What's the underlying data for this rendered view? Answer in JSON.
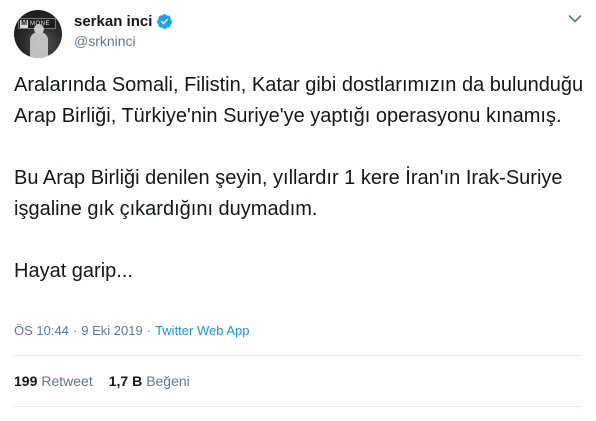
{
  "author": {
    "display_name": "serkan inci",
    "handle": "@srkninci",
    "avatar_badge": "MONE",
    "avatar_badge_letter": "M",
    "verified": true
  },
  "tweet": {
    "paragraphs": [
      "Aralarında Somali, Filistin, Katar gibi dostlarımızın da bulunduğu Arap Birliği, Türkiye'nin Suriye'ye yaptığı operasyonu kınamış.",
      "Bu Arap Birliği denilen şeyin, yıllardır 1 kere İran'ın Irak-Suriye işgaline gık çıkardığını duymadım.",
      "Hayat garip..."
    ],
    "time": "ÖS 10:44",
    "separator": "·",
    "date": "9 Eki 2019",
    "app": "Twitter Web App"
  },
  "stats": {
    "retweets_count": "199",
    "retweets_label": "Retweet",
    "likes_count": "1,7 B",
    "likes_label": "Beğeni"
  },
  "colors": {
    "verified": "#1da1f2",
    "link": "#1b95e0",
    "secondary_text": "#657786",
    "divider": "#e6ecf0"
  },
  "icons": {
    "verified": "verified-badge-icon",
    "menu": "chevron-down-icon"
  }
}
